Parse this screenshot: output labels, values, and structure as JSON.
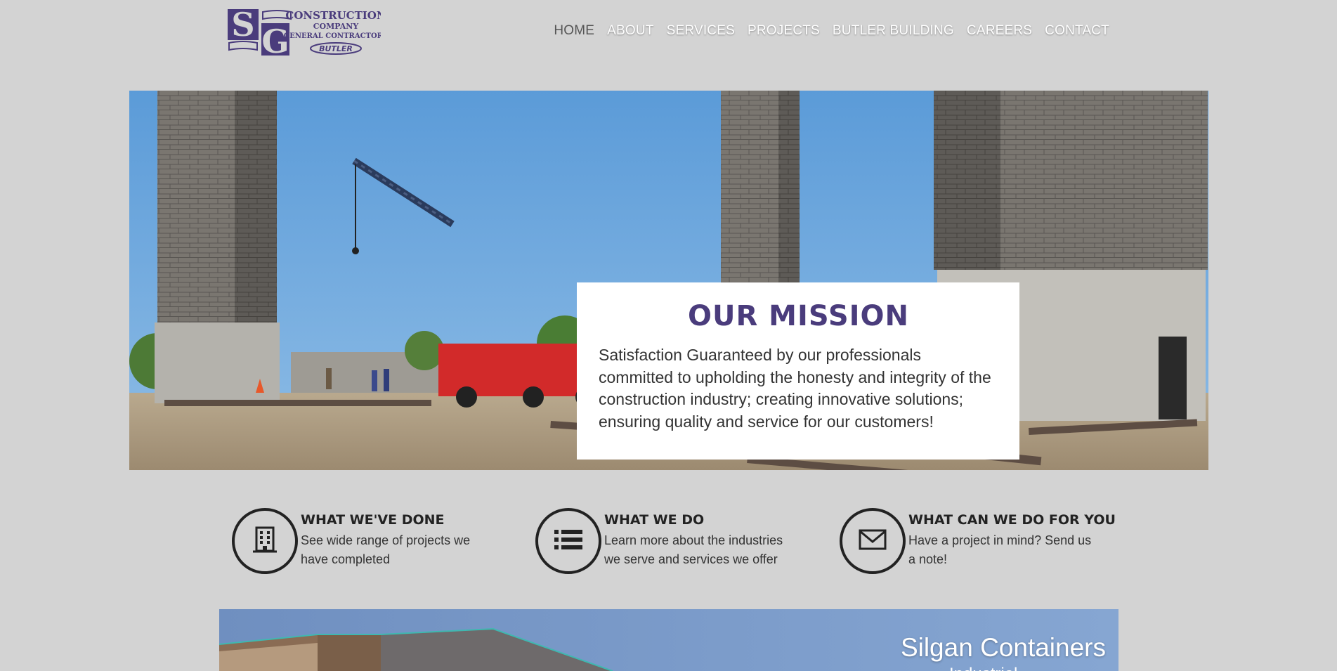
{
  "header": {
    "logo": {
      "letters": "SG",
      "line1": "CONSTRUCTION",
      "line2": "COMPANY",
      "line3": "GENERAL CONTRACTORS",
      "badge": "BUTLER",
      "color": "#4a3c7c"
    },
    "nav": [
      {
        "label": "HOME",
        "active": true
      },
      {
        "label": "ABOUT"
      },
      {
        "label": "SERVICES"
      },
      {
        "label": "PROJECTS"
      },
      {
        "label": "BUTLER BUILDING"
      },
      {
        "label": "CAREERS"
      },
      {
        "label": "CONTACT"
      }
    ]
  },
  "hero": {
    "title": "OUR MISSION",
    "text": "Satisfaction Guaranteed by our professionals committed to upholding the honesty and integrity of the construction industry; creating innovative solutions; ensuring quality and service for our customers!"
  },
  "features": [
    {
      "icon": "building-icon",
      "title": "WHAT WE'VE DONE",
      "desc": "See wide range of projects we have completed"
    },
    {
      "icon": "list-icon",
      "title": "WHAT WE DO",
      "desc": "Learn more about the industries we serve and services we offer"
    },
    {
      "icon": "envelope-icon",
      "title": "WHAT CAN WE DO FOR YOU",
      "desc": "Have a project in mind? Send us a note!"
    }
  ],
  "project": {
    "title": "Silgan Containers",
    "subtitle": "Industrial"
  },
  "colors": {
    "background": "#d3d3d3",
    "brand": "#4a3c7c",
    "nav_text": "#ffffff",
    "nav_active": "#555555"
  }
}
